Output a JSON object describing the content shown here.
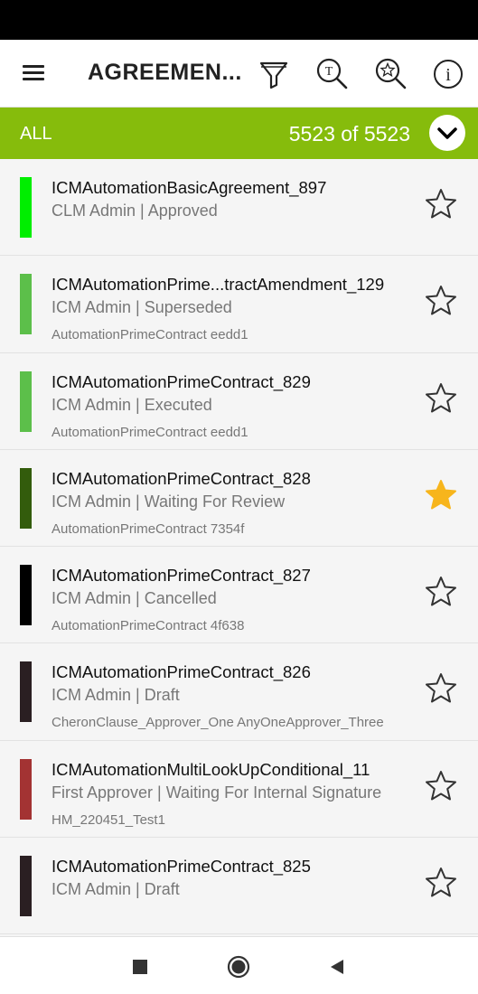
{
  "header": {
    "title": "AGREEMEN...",
    "icons": [
      "menu-icon",
      "filter-icon",
      "text-search-icon",
      "saved-search-icon",
      "info-icon"
    ]
  },
  "filter": {
    "label": "ALL",
    "count": "5523 of 5523",
    "dropdown_icon": "chevron-down-icon",
    "bar_color": "#86bc0c"
  },
  "agreements": [
    {
      "title": "ICMAutomationBasicAgreement_897",
      "subtitle": "CLM Admin | Approved",
      "extra": "",
      "status_color": "#00ee00",
      "starred": false
    },
    {
      "title": "ICMAutomationPrime...tractAmendment_129",
      "subtitle": "ICM Admin | Superseded",
      "extra": "AutomationPrimeContract eedd1",
      "status_color": "#5cbf4a",
      "starred": false
    },
    {
      "title": "ICMAutomationPrimeContract_829",
      "subtitle": "ICM Admin | Executed",
      "extra": "AutomationPrimeContract eedd1",
      "status_color": "#5cbf4a",
      "starred": false
    },
    {
      "title": "ICMAutomationPrimeContract_828",
      "subtitle": "ICM Admin | Waiting For Review",
      "extra": "AutomationPrimeContract 7354f",
      "status_color": "#335c0c",
      "starred": true
    },
    {
      "title": "ICMAutomationPrimeContract_827",
      "subtitle": "ICM Admin | Cancelled",
      "extra": "AutomationPrimeContract 4f638",
      "status_color": "#000000",
      "starred": false
    },
    {
      "title": "ICMAutomationPrimeContract_826",
      "subtitle": "ICM Admin | Draft",
      "extra": "CheronClause_Approver_One AnyOneApprover_Three",
      "status_color": "#2a1f22",
      "starred": false
    },
    {
      "title": "ICMAutomationMultiLookUpConditional_11",
      "subtitle": "First Approver | Waiting For Internal Signature",
      "extra": "HM_220451_Test1",
      "status_color": "#a33333",
      "starred": false
    },
    {
      "title": "ICMAutomationPrimeContract_825",
      "subtitle": "ICM Admin | Draft",
      "extra": "",
      "status_color": "#2a1f22",
      "starred": false
    }
  ],
  "colors": {
    "star_filled": "#f7b51c",
    "star_outline": "#333333"
  },
  "nav": {
    "icons": [
      "recents-square-icon",
      "home-circle-icon",
      "back-triangle-icon"
    ]
  }
}
